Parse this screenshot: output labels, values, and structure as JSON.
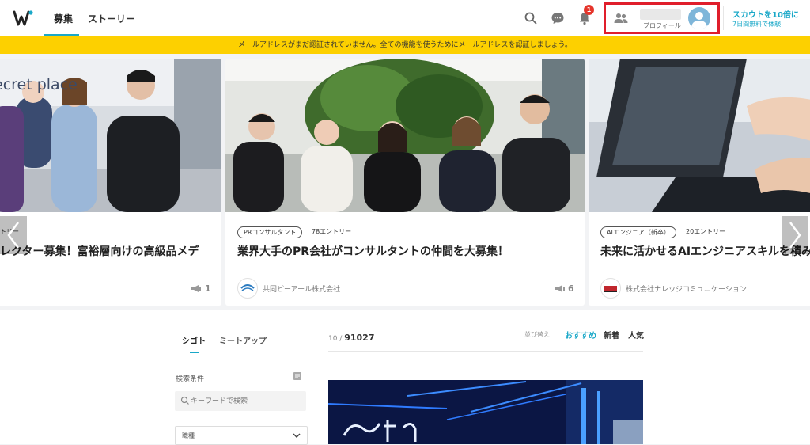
{
  "header": {
    "tabs": [
      {
        "label": "募集"
      },
      {
        "label": "ストーリー"
      }
    ],
    "notification_count": "1",
    "profile_label": "プロフィール",
    "scout_title": "スカウトを10倍に",
    "scout_sub": "7日間無料で体験"
  },
  "banner": {
    "text": "メールアドレスがまだ認証されていません。全ての機能を使うためにメールアドレスを認証しましょう。"
  },
  "carousel": {
    "cards": [
      {
        "tag": "",
        "entries": "トリー",
        "title": "レクター募集！富裕層向けの高級品メデ",
        "company": "",
        "count": "1"
      },
      {
        "tag": "PRコンサルタント",
        "entries": "78エントリー",
        "title": "業界大手のPR会社がコンサルタントの仲間を大募集！",
        "company": "共同ピーアール株式会社",
        "count": "6"
      },
      {
        "tag": "AIエンジニア（新卒）",
        "entries": "20エントリー",
        "title": "未来に活かせるAIエンジニアスキルを積み",
        "company": "株式会社ナレッジコミュニケーション",
        "count": ""
      }
    ],
    "card1_sign": "ecret place"
  },
  "sidebar": {
    "tabs": [
      {
        "label": "シゴト"
      },
      {
        "label": "ミートアップ"
      }
    ],
    "filter_label": "検索条件",
    "search_placeholder": "キーワードで検索",
    "select_label": "職種"
  },
  "results": {
    "count_prefix": "10 / ",
    "count_total": "91027",
    "sort_label": "並び替え",
    "sort_options": [
      {
        "label": "おすすめ"
      },
      {
        "label": "新着"
      },
      {
        "label": "人気"
      }
    ]
  },
  "colors": {
    "accent": "#1aa8c8",
    "banner": "#fdd000",
    "badge": "#e5352b",
    "highlight": "#e01e2b"
  }
}
